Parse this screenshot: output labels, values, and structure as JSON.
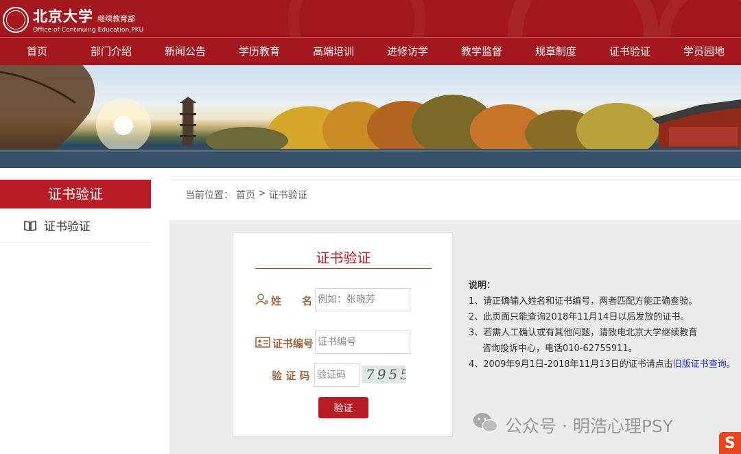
{
  "header": {
    "logo_cn": "北京大学",
    "logo_sub": "继续教育部",
    "logo_en": "Office of Continuing Education.PKU"
  },
  "nav": {
    "items": [
      {
        "label": "首页"
      },
      {
        "label": "部门介绍"
      },
      {
        "label": "新闻公告"
      },
      {
        "label": "学历教育"
      },
      {
        "label": "高端培训"
      },
      {
        "label": "进修访学"
      },
      {
        "label": "教学监督"
      },
      {
        "label": "规章制度"
      },
      {
        "label": "证书验证"
      },
      {
        "label": "学员园地"
      }
    ]
  },
  "sidebar": {
    "title": "证书验证",
    "items": [
      {
        "label": "证书验证",
        "icon": "open-book-icon"
      }
    ]
  },
  "breadcrumb": {
    "prefix": "当前位置：",
    "home": "首页",
    "separator": ">",
    "current": "证书验证"
  },
  "form": {
    "title": "证书验证",
    "name_label": "姓　　名",
    "name_placeholder": "例如：张晓芳",
    "cert_label": "证书编号",
    "cert_placeholder": "证书编号",
    "captcha_label": "验 证 码",
    "captcha_placeholder": "验证码",
    "captcha_text": "7955",
    "submit_label": "验证"
  },
  "notes": {
    "title": "说明：",
    "line1": "1、请正确输入姓名和证书编号，两者匹配方能正确查验。",
    "line2": "2、此页面只能查询2018年11月14日以后发放的证书。",
    "line3a": "3、若需人工确认或有其他问题，请致电北京大学继续教育",
    "line3b": "咨询投诉中心，电话010-62755911。",
    "line4_prefix": "4、2009年9月1日-2018年11月13日的证书请点击",
    "line4_link": "旧版证书查询",
    "line4_suffix": "。"
  },
  "watermark": {
    "text": "公众号 · 明浩心理PSY"
  },
  "colors": {
    "brand_red": "#a3171e",
    "sidebar_red": "#b71c24",
    "link_blue": "#1a35c8",
    "label_brown": "#9b6a48"
  }
}
